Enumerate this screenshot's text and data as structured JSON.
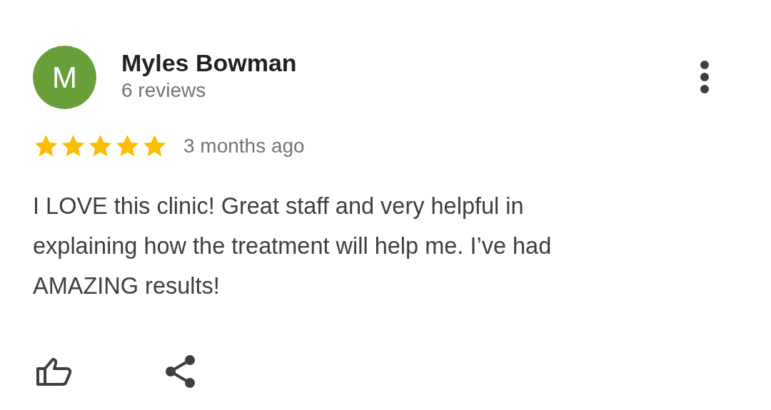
{
  "review": {
    "avatar_letter": "M",
    "author": "Myles Bowman",
    "reviews_count": "6 reviews",
    "stars": 5,
    "time": "3 months ago",
    "text": "I LOVE this clinic! Great staff and very helpful in explaining how the treatment will help me. I’ve had AMAZING results!"
  }
}
